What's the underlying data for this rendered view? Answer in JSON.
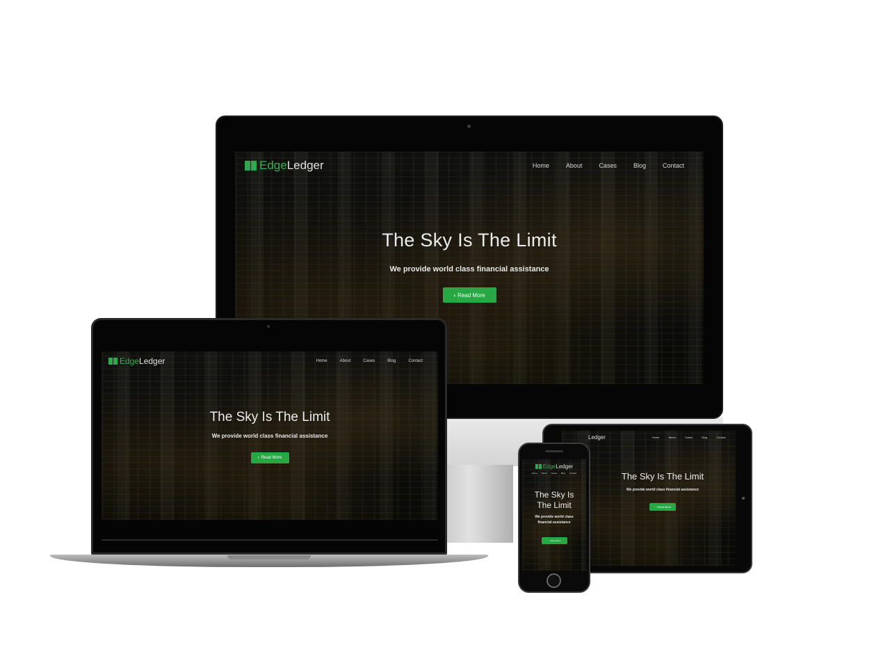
{
  "site": {
    "brand_part1": "Edge",
    "brand_part2": "Ledger",
    "nav": [
      "Home",
      "About",
      "Cases",
      "Blog",
      "Contact"
    ],
    "headline": "The Sky Is The Limit",
    "phone_headline_line1": "The Sky Is",
    "phone_headline_line2": "The Limit",
    "tagline": "We provide world class financial assistance",
    "phone_tagline_line1": "We provide world class",
    "phone_tagline_line2": "financial assistance",
    "cta_icon": "chevron-right-icon",
    "cta_label": "Read More"
  },
  "colors": {
    "brand_green": "#35b24f",
    "button_green": "#27a844",
    "screen_dark": "#0d0f0c"
  }
}
